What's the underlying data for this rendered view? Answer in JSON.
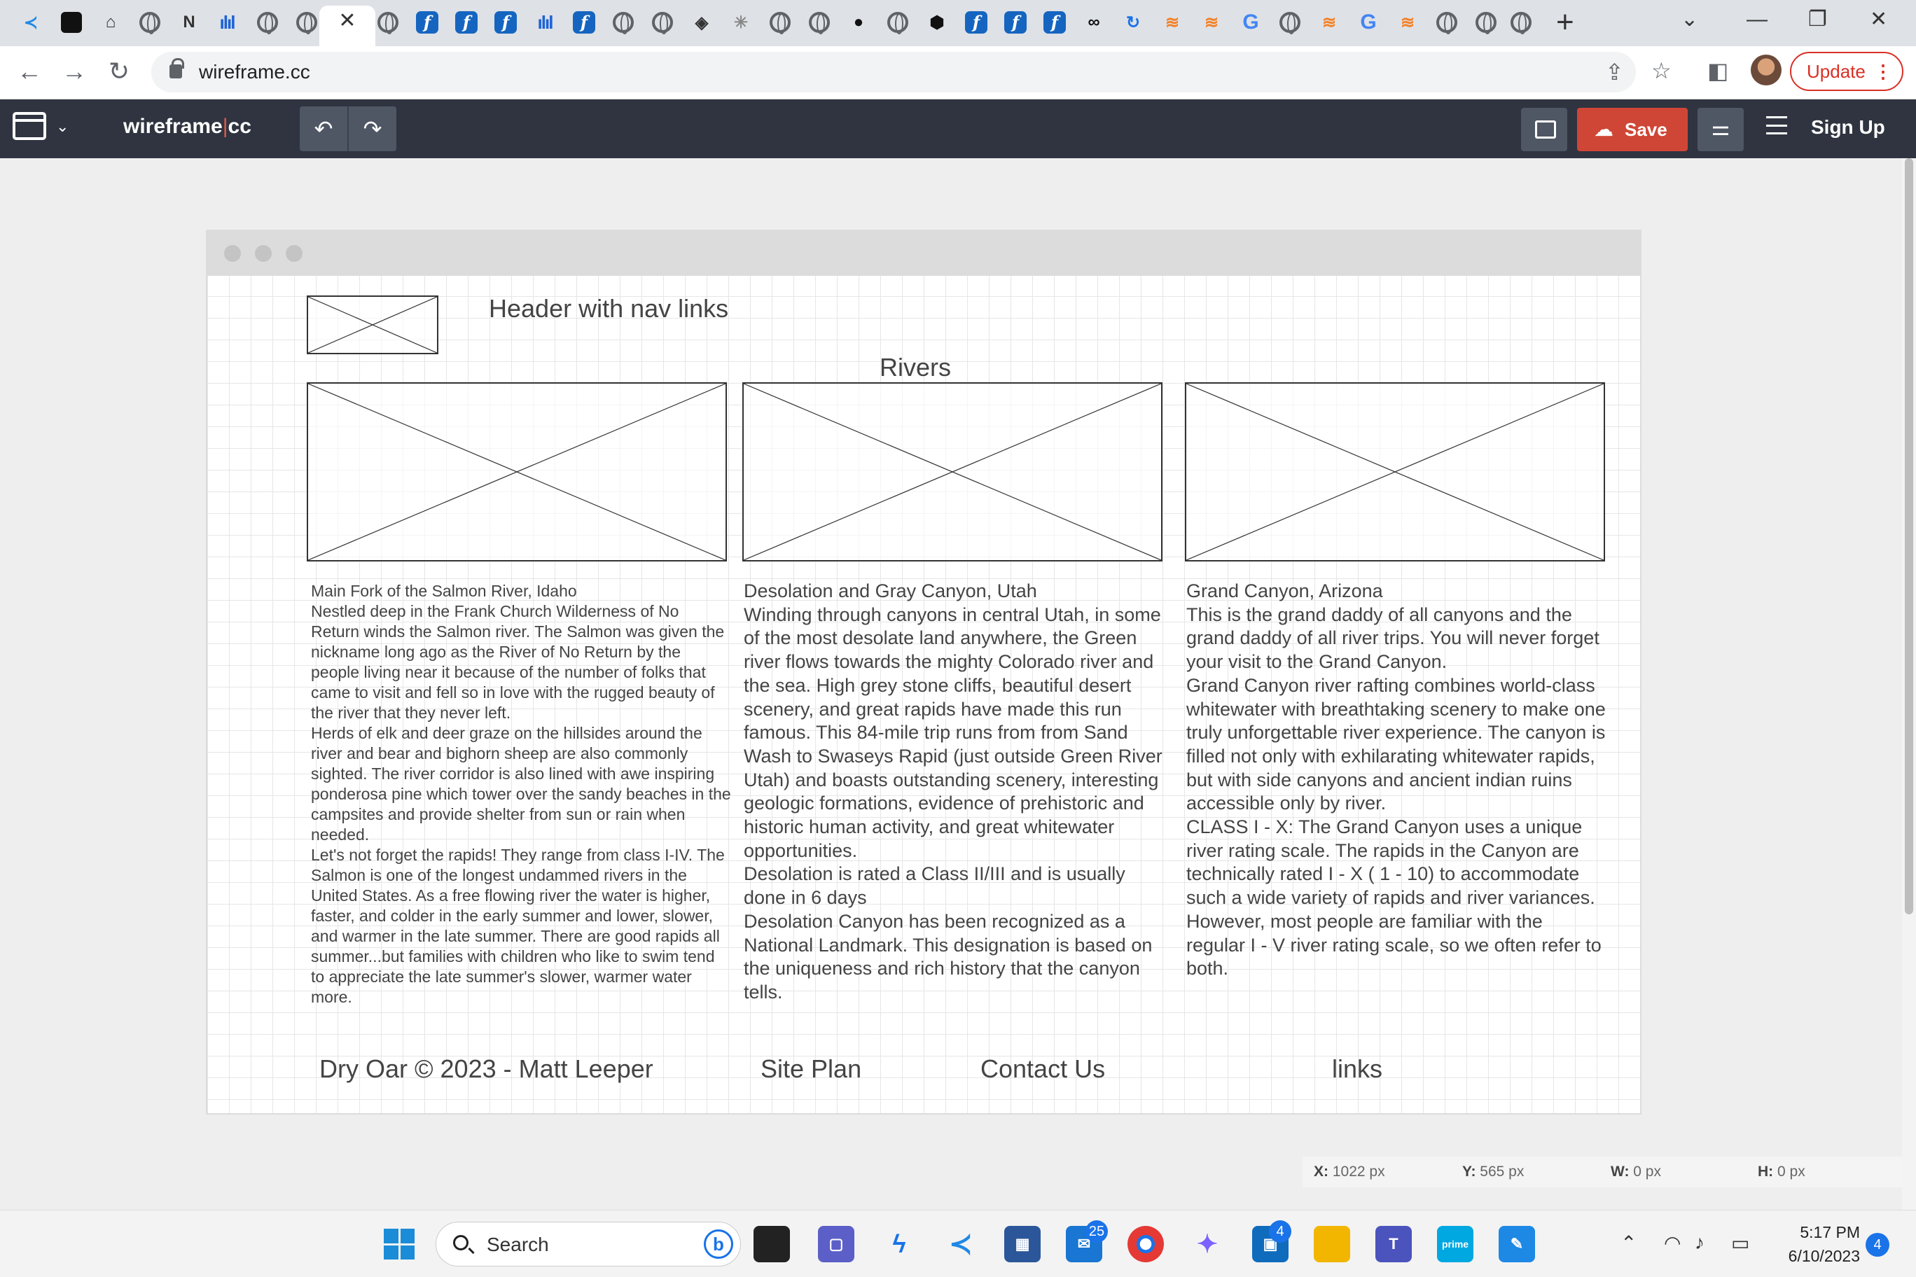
{
  "browser": {
    "url": "wireframe.cc",
    "update_label": "Update",
    "update_menu": "⋮"
  },
  "app": {
    "logo_left": "wireframe",
    "logo_sep": "|",
    "logo_right": "cc",
    "save_label": "Save",
    "signup_label": "Sign Up"
  },
  "wireframe": {
    "header_label": "Header with nav links",
    "section_title": "Rivers",
    "columns": [
      {
        "paragraphs": [
          "Main Fork of the Salmon River, Idaho",
          "Nestled deep in the Frank Church Wilderness of No Return winds the Salmon river. The Salmon was given the nickname long ago as the River of No Return by the people living near it because of the number of folks that came to visit and fell so in love with the rugged beauty of the river that they never left.",
          "Herds of elk and deer graze on the hillsides around the river and bear and bighorn sheep are also commonly sighted. The river corridor is also lined with awe inspiring ponderosa pine which tower over the sandy beaches in the campsites and provide shelter from sun or rain when needed.",
          "Let's not forget the rapids! They range from class I-IV. The Salmon is one of the longest undammed rivers in the United States. As a free flowing river the water is higher, faster, and colder in the early summer and lower, slower, and warmer in the late summer. There are good rapids all summer...but families with children who like to swim tend to appreciate the late summer's slower, warmer water more."
        ]
      },
      {
        "paragraphs": [
          "Desolation and Gray Canyon, Utah",
          "Winding through canyons in central Utah, in some of the most desolate land anywhere, the Green river flows towards the mighty Colorado river and the sea. High grey stone cliffs, beautiful desert scenery, and great rapids have made this run famous. This 84-mile trip runs from from Sand Wash to Swaseys Rapid (just outside Green River Utah) and boasts outstanding scenery, interesting geologic formations, evidence of prehistoric and historic human activity, and great whitewater opportunities.",
          "Desolation is rated a Class II/III and is usually done in 6 days",
          "Desolation Canyon has been recognized as a National Landmark. This designation is based on the uniqueness and rich history that the canyon tells."
        ]
      },
      {
        "paragraphs": [
          "Grand Canyon, Arizona",
          "This is the grand daddy of all canyons and the grand daddy of all river trips. You will never forget your visit to the Grand Canyon.",
          "Grand Canyon river rafting combines world-class whitewater with breathtaking scenery to make one truly unforgettable river experience. The canyon is filled not only with exhilarating whitewater rapids, but with side canyons and ancient indian ruins accessible only by river.",
          "CLASS I - X: The Grand Canyon uses a unique river rating scale. The rapids in the Canyon are technically rated I - X ( 1 - 10) to accommodate such a wide variety of rapids and river variances. However, most people are familiar with the regular I - V river rating scale, so we often refer to both."
        ]
      }
    ],
    "footer": {
      "copyright": "Dry Oar © 2023 - Matt Leeper",
      "site_plan": "Site Plan",
      "contact": "Contact Us",
      "links": "links"
    }
  },
  "readout": {
    "x_label": "X:",
    "x_value": "1022 px",
    "y_label": "Y:",
    "y_value": "565 px",
    "w_label": "W:",
    "w_value": "0 px",
    "h_label": "H:",
    "h_value": "0 px"
  },
  "taskbar": {
    "search_placeholder": "Search",
    "mail_badge": "25",
    "store_badge": "4",
    "time": "5:17 PM",
    "date": "6/10/2023",
    "notifications": "4"
  },
  "colors": {
    "appbar": "#2f3440",
    "save": "#cf4636",
    "brand_separator": "#e05a47"
  }
}
